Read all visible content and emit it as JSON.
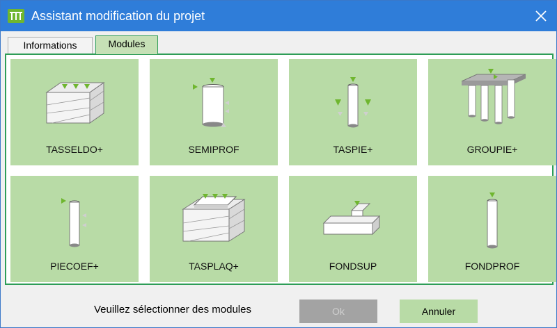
{
  "window": {
    "title": "Assistant modification du projet",
    "app_icon": "tm-logo-icon",
    "close_icon": "close-icon"
  },
  "colors": {
    "titlebar": "#2f7dd9",
    "accent": "#2e9d57",
    "tile": "#b8dba6",
    "arrow": "#6fb62f",
    "disabled_button": "#a3a3a3"
  },
  "tabs": [
    {
      "label": "Informations",
      "active": false
    },
    {
      "label": "Modules",
      "active": true
    }
  ],
  "modules": [
    {
      "label": "TASSELDO+",
      "icon": "soil-block-icon"
    },
    {
      "label": "SEMIPROF",
      "icon": "semi-deep-foundation-icon"
    },
    {
      "label": "TASPIE+",
      "icon": "pile-settlement-icon"
    },
    {
      "label": "GROUPIE+",
      "icon": "pile-group-icon"
    },
    {
      "label": "PIECOEF+",
      "icon": "pile-coefficient-icon"
    },
    {
      "label": "TASPLAQ+",
      "icon": "slab-soil-block-icon"
    },
    {
      "label": "FONDSUP",
      "icon": "shallow-foundation-icon"
    },
    {
      "label": "FONDPROF",
      "icon": "deep-foundation-icon"
    }
  ],
  "footer": {
    "message": "Veuillez sélectionner des modules",
    "ok_label": "Ok",
    "ok_enabled": false,
    "cancel_label": "Annuler"
  }
}
